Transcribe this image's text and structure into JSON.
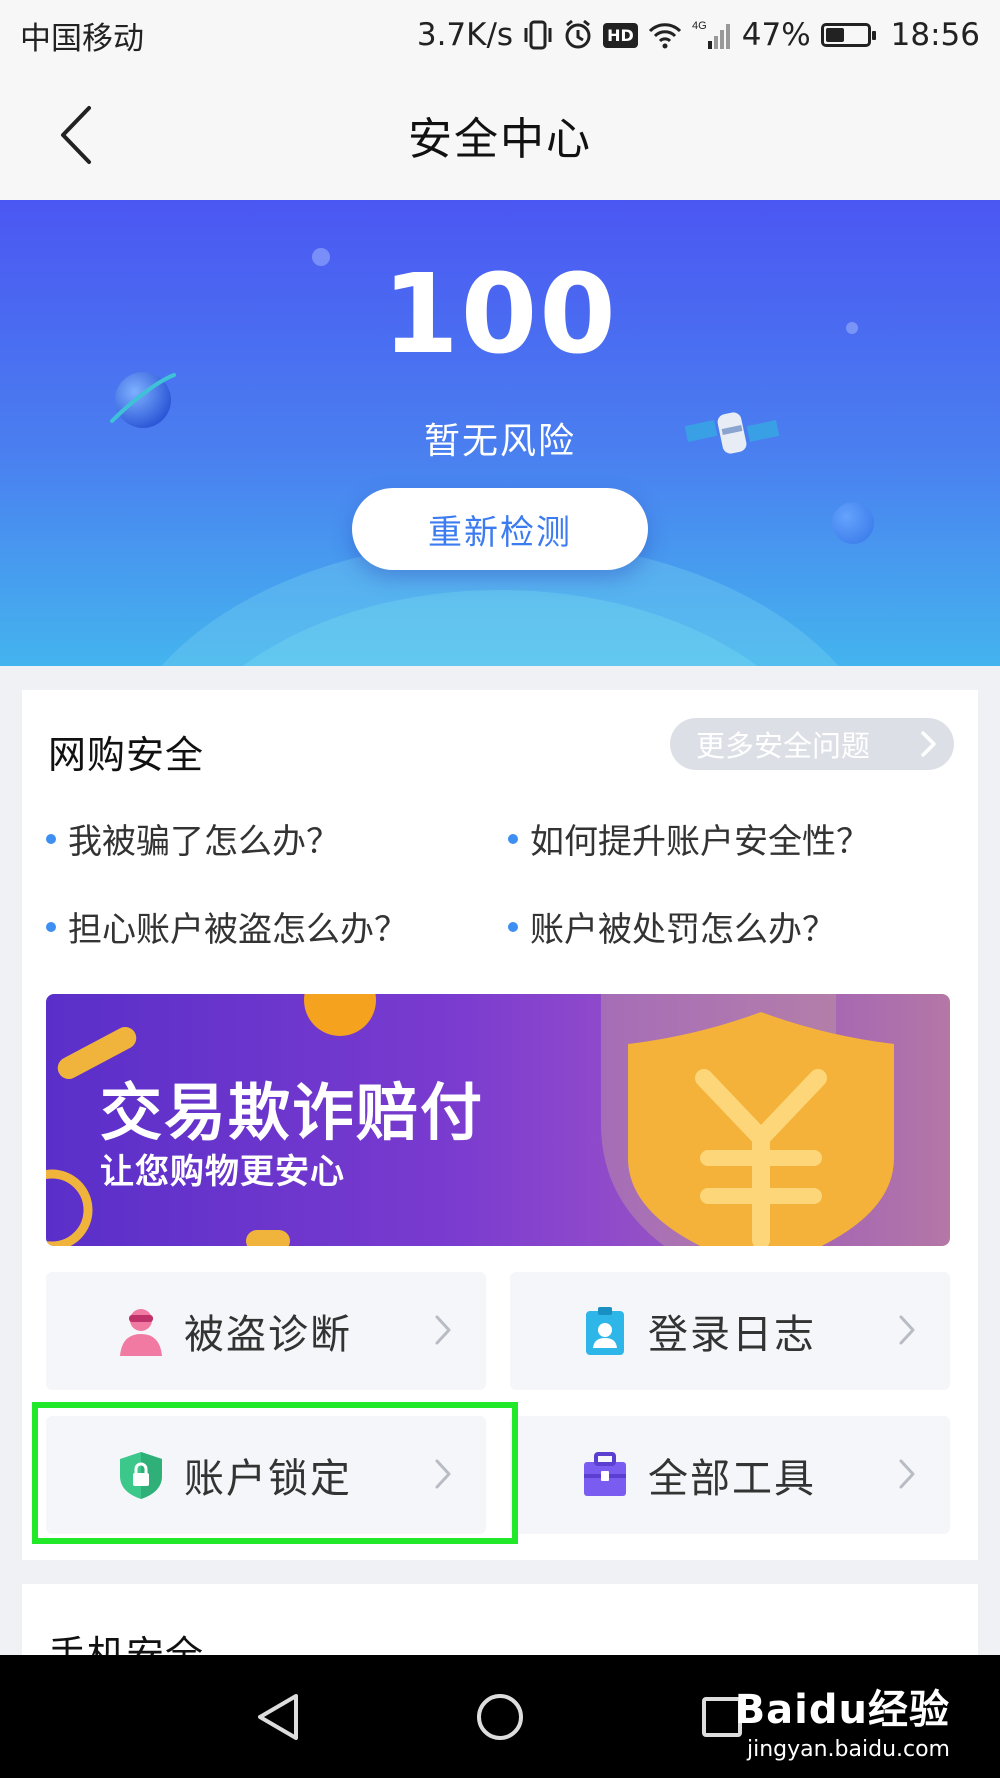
{
  "status_bar": {
    "carrier": "中国移动",
    "speed": "3.7K/s",
    "hd_badge": "HD",
    "network": "4G",
    "battery": "47%",
    "battery_level": 0.47,
    "time": "18:56"
  },
  "nav": {
    "title": "安全中心"
  },
  "hero": {
    "score": "100",
    "risk_text": "暂无风险",
    "recheck_label": "重新检测"
  },
  "online_shopping": {
    "title": "网购安全",
    "more_label": "更多安全问题",
    "questions": [
      "我被骗了怎么办？",
      "如何提升账户安全性？",
      "担心账户被盗怎么办？",
      "账户被处罚怎么办？"
    ],
    "banner": {
      "title": "交易欺诈赔付",
      "subtitle": "让您购物更安心"
    },
    "tools": [
      {
        "label": "被盗诊断",
        "icon": "thief-icon"
      },
      {
        "label": "登录日志",
        "icon": "login-log-icon"
      },
      {
        "label": "账户锁定",
        "icon": "shield-lock-icon"
      },
      {
        "label": "全部工具",
        "icon": "toolbox-icon"
      }
    ]
  },
  "phone_security": {
    "title": "手机安全"
  },
  "watermark": {
    "brand": "Baidu经验",
    "url": "jingyan.baidu.com"
  },
  "colors": {
    "hero_top": "#4b57f2",
    "hero_bottom": "#44b4ee",
    "accent_blue": "#3d7cf0",
    "banner_purple": "#7a3bcf",
    "highlight_green": "#22e82a"
  }
}
